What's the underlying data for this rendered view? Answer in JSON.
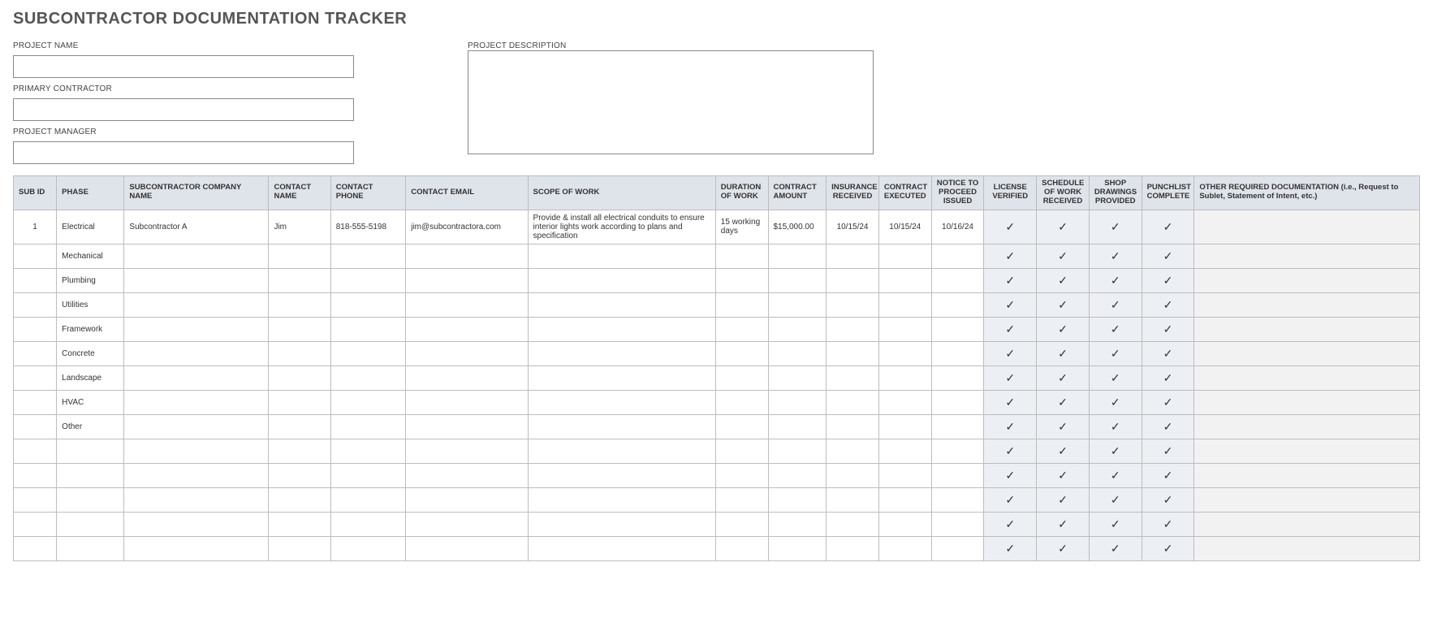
{
  "title": "SUBCONTRACTOR DOCUMENTATION TRACKER",
  "fields": {
    "project_name_label": "PROJECT NAME",
    "primary_contractor_label": "PRIMARY CONTRACTOR",
    "project_manager_label": "PROJECT MANAGER",
    "project_description_label": "PROJECT DESCRIPTION",
    "project_name_value": "",
    "primary_contractor_value": "",
    "project_manager_value": "",
    "project_description_value": ""
  },
  "columns": [
    "SUB ID",
    "PHASE",
    "SUBCONTRACTOR COMPANY NAME",
    "CONTACT NAME",
    "CONTACT PHONE",
    "CONTACT EMAIL",
    "SCOPE OF WORK",
    "DURATION OF WORK",
    "CONTRACT AMOUNT",
    "INSURANCE RECEIVED",
    "CONTRACT EXECUTED",
    "NOTICE TO PROCEED ISSUED",
    "LICENSE VERIFIED",
    "SCHEDULE OF WORK RECEIVED",
    "SHOP DRAWINGS PROVIDED",
    "PUNCHLIST COMPLETE",
    "OTHER REQUIRED DOCUMENTATION (i.e., Request to Sublet, Statement of Intent, etc.)"
  ],
  "rows": [
    {
      "sub_id": "1",
      "phase": "Electrical",
      "company": "Subcontractor A",
      "contact_name": "Jim",
      "contact_phone": "818-555-5198",
      "contact_email": "jim@subcontractora.com",
      "scope": "Provide & install all electrical conduits to ensure interior lights work according to plans and specification",
      "duration": "15 working days",
      "amount": "$15,000.00",
      "insurance": "10/15/24",
      "executed": "10/15/24",
      "notice": "10/16/24",
      "license": true,
      "schedule": true,
      "shop": true,
      "punchlist": true,
      "other": ""
    },
    {
      "sub_id": "",
      "phase": "Mechanical",
      "company": "",
      "contact_name": "",
      "contact_phone": "",
      "contact_email": "",
      "scope": "",
      "duration": "",
      "amount": "",
      "insurance": "",
      "executed": "",
      "notice": "",
      "license": true,
      "schedule": true,
      "shop": true,
      "punchlist": true,
      "other": ""
    },
    {
      "sub_id": "",
      "phase": "Plumbing",
      "company": "",
      "contact_name": "",
      "contact_phone": "",
      "contact_email": "",
      "scope": "",
      "duration": "",
      "amount": "",
      "insurance": "",
      "executed": "",
      "notice": "",
      "license": true,
      "schedule": true,
      "shop": true,
      "punchlist": true,
      "other": ""
    },
    {
      "sub_id": "",
      "phase": "Utilities",
      "company": "",
      "contact_name": "",
      "contact_phone": "",
      "contact_email": "",
      "scope": "",
      "duration": "",
      "amount": "",
      "insurance": "",
      "executed": "",
      "notice": "",
      "license": true,
      "schedule": true,
      "shop": true,
      "punchlist": true,
      "other": ""
    },
    {
      "sub_id": "",
      "phase": "Framework",
      "company": "",
      "contact_name": "",
      "contact_phone": "",
      "contact_email": "",
      "scope": "",
      "duration": "",
      "amount": "",
      "insurance": "",
      "executed": "",
      "notice": "",
      "license": true,
      "schedule": true,
      "shop": true,
      "punchlist": true,
      "other": ""
    },
    {
      "sub_id": "",
      "phase": "Concrete",
      "company": "",
      "contact_name": "",
      "contact_phone": "",
      "contact_email": "",
      "scope": "",
      "duration": "",
      "amount": "",
      "insurance": "",
      "executed": "",
      "notice": "",
      "license": true,
      "schedule": true,
      "shop": true,
      "punchlist": true,
      "other": ""
    },
    {
      "sub_id": "",
      "phase": "Landscape",
      "company": "",
      "contact_name": "",
      "contact_phone": "",
      "contact_email": "",
      "scope": "",
      "duration": "",
      "amount": "",
      "insurance": "",
      "executed": "",
      "notice": "",
      "license": true,
      "schedule": true,
      "shop": true,
      "punchlist": true,
      "other": ""
    },
    {
      "sub_id": "",
      "phase": "HVAC",
      "company": "",
      "contact_name": "",
      "contact_phone": "",
      "contact_email": "",
      "scope": "",
      "duration": "",
      "amount": "",
      "insurance": "",
      "executed": "",
      "notice": "",
      "license": true,
      "schedule": true,
      "shop": true,
      "punchlist": true,
      "other": ""
    },
    {
      "sub_id": "",
      "phase": "Other",
      "company": "",
      "contact_name": "",
      "contact_phone": "",
      "contact_email": "",
      "scope": "",
      "duration": "",
      "amount": "",
      "insurance": "",
      "executed": "",
      "notice": "",
      "license": true,
      "schedule": true,
      "shop": true,
      "punchlist": true,
      "other": ""
    },
    {
      "sub_id": "",
      "phase": "",
      "company": "",
      "contact_name": "",
      "contact_phone": "",
      "contact_email": "",
      "scope": "",
      "duration": "",
      "amount": "",
      "insurance": "",
      "executed": "",
      "notice": "",
      "license": true,
      "schedule": true,
      "shop": true,
      "punchlist": true,
      "other": ""
    },
    {
      "sub_id": "",
      "phase": "",
      "company": "",
      "contact_name": "",
      "contact_phone": "",
      "contact_email": "",
      "scope": "",
      "duration": "",
      "amount": "",
      "insurance": "",
      "executed": "",
      "notice": "",
      "license": true,
      "schedule": true,
      "shop": true,
      "punchlist": true,
      "other": ""
    },
    {
      "sub_id": "",
      "phase": "",
      "company": "",
      "contact_name": "",
      "contact_phone": "",
      "contact_email": "",
      "scope": "",
      "duration": "",
      "amount": "",
      "insurance": "",
      "executed": "",
      "notice": "",
      "license": true,
      "schedule": true,
      "shop": true,
      "punchlist": true,
      "other": ""
    },
    {
      "sub_id": "",
      "phase": "",
      "company": "",
      "contact_name": "",
      "contact_phone": "",
      "contact_email": "",
      "scope": "",
      "duration": "",
      "amount": "",
      "insurance": "",
      "executed": "",
      "notice": "",
      "license": true,
      "schedule": true,
      "shop": true,
      "punchlist": true,
      "other": ""
    },
    {
      "sub_id": "",
      "phase": "",
      "company": "",
      "contact_name": "",
      "contact_phone": "",
      "contact_email": "",
      "scope": "",
      "duration": "",
      "amount": "",
      "insurance": "",
      "executed": "",
      "notice": "",
      "license": true,
      "schedule": true,
      "shop": true,
      "punchlist": true,
      "other": ""
    }
  ],
  "check_glyph": "✓"
}
